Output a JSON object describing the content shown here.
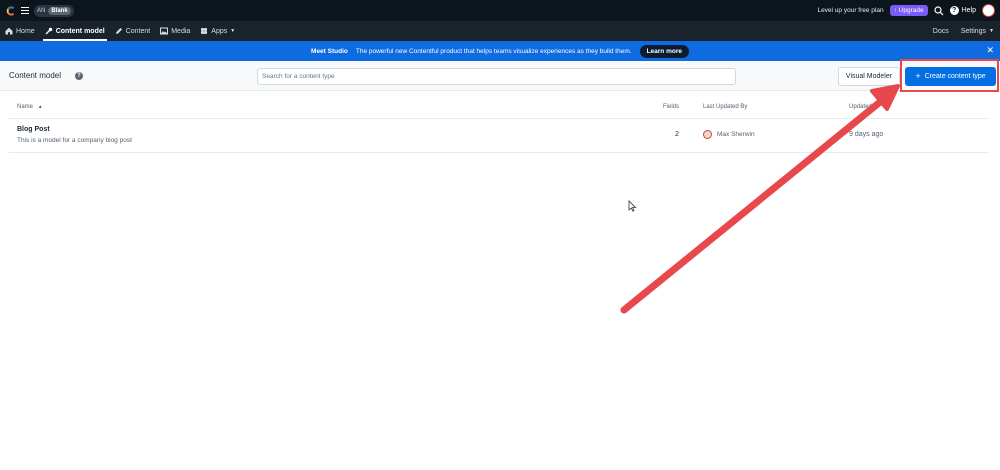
{
  "topbar": {
    "space_initials": "AN",
    "environment": "Blank",
    "free_plan_text": "Level up your free plan",
    "upgrade_label": "↑ Upgrade",
    "help_label": "Help",
    "icons": [
      "contentful-logo-icon",
      "menu-icon",
      "search-icon",
      "help-icon",
      "avatar"
    ]
  },
  "nav": {
    "items": [
      {
        "label": "Home",
        "icon": "home-icon"
      },
      {
        "label": "Content model",
        "icon": "wrench-icon",
        "active": true
      },
      {
        "label": "Content",
        "icon": "pen-icon"
      },
      {
        "label": "Media",
        "icon": "image-icon"
      },
      {
        "label": "Apps",
        "icon": "apps-icon"
      }
    ],
    "docs_label": "Docs",
    "settings_label": "Settings"
  },
  "banner": {
    "title": "Meet Studio",
    "text": "The powerful new Contentful product that helps teams visualize experiences as they build them.",
    "button": "Learn more"
  },
  "header": {
    "title": "Content model",
    "search_placeholder": "Search for a content type",
    "visual_modeler_label": "Visual Modeler",
    "create_label": "Create content type"
  },
  "table": {
    "columns": {
      "name": "Name",
      "fields": "Fields",
      "last_updated_by": "Last Updated By",
      "updated": "Updated"
    },
    "rows": [
      {
        "name": "Blog Post",
        "description": "This is a model for a company blog post",
        "fields": "2",
        "updated_by": "Max Sherwin",
        "updated": "9 days ago"
      }
    ]
  },
  "colors": {
    "topbar": "#0c141c",
    "navbar": "#1a222b",
    "banner": "#0e6be0",
    "primary_button": "#036fe3",
    "annotation": "#e7484b"
  }
}
